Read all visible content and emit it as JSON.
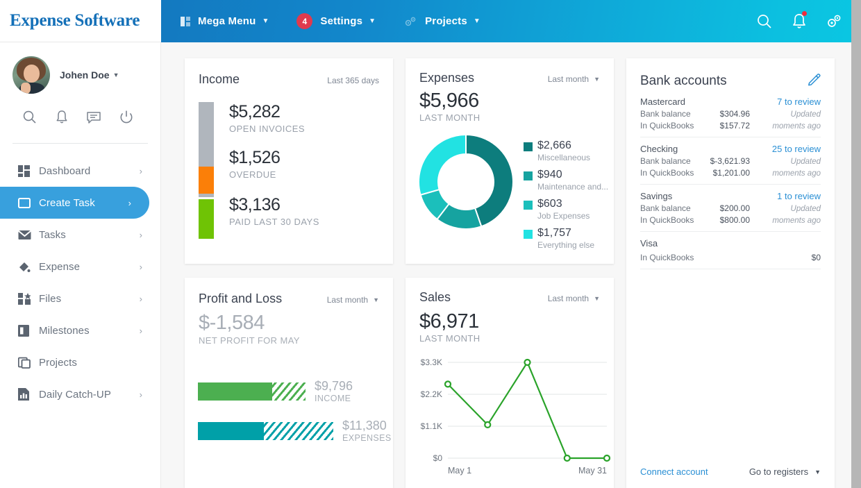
{
  "brand": {
    "title": "Expense Software"
  },
  "navbar": {
    "items": [
      {
        "label": "Mega Menu",
        "icon": "grid-icon",
        "caret": "▼",
        "badge": null
      },
      {
        "label": "Settings",
        "icon": "badge-icon",
        "caret": "▼",
        "badge": "4"
      },
      {
        "label": "Projects",
        "icon": "gears-icon",
        "caret": "▼",
        "badge": null
      }
    ],
    "right_icons": [
      "search-icon",
      "bell-icon",
      "settings-gear-icon"
    ]
  },
  "sidebar": {
    "profile": {
      "name": "Johen Doe",
      "caret": "▼",
      "avatar": "user-avatar"
    },
    "quick_icons": [
      "search-icon",
      "bell-icon",
      "chat-icon",
      "power-icon"
    ],
    "items": [
      {
        "label": "Dashboard",
        "icon": "dashboard-icon",
        "arrow": "›",
        "active": false
      },
      {
        "label": "Create Task",
        "icon": "window-icon",
        "arrow": "›",
        "active": true
      },
      {
        "label": "Tasks",
        "icon": "envelope-icon",
        "arrow": "›",
        "active": false
      },
      {
        "label": "Expense",
        "icon": "paint-icon",
        "arrow": "›",
        "active": false
      },
      {
        "label": "Files",
        "icon": "files-icon",
        "arrow": "›",
        "active": false
      },
      {
        "label": "Milestones",
        "icon": "milestones-icon",
        "arrow": "›",
        "active": false
      },
      {
        "label": "Projects",
        "icon": "projects-icon",
        "arrow": "",
        "active": false
      },
      {
        "label": "Daily Catch-UP",
        "icon": "report-icon",
        "arrow": "›",
        "active": false
      }
    ]
  },
  "income_card": {
    "title": "Income",
    "period": "Last 365 days",
    "rows": [
      {
        "amount": "$5,282",
        "label": "OPEN INVOICES",
        "color": "#b0b6bd"
      },
      {
        "amount": "$1,526",
        "label": "OVERDUE",
        "color": "#fb7f08"
      },
      {
        "amount": "$3,136",
        "label": "PAID LAST 30 DAYS",
        "color": "#6fc305"
      }
    ]
  },
  "expenses_card": {
    "title": "Expenses",
    "period": "Last month",
    "caret": "▼",
    "total": "$5,966",
    "total_label": "LAST MONTH",
    "chart_data": {
      "type": "pie",
      "title": "Expenses",
      "labels": [
        "Miscellaneous",
        "Maintenance and...",
        "Job Expenses",
        "Everything else"
      ],
      "values": [
        2666,
        940,
        603,
        1757
      ],
      "value_labels": [
        "$2,666",
        "$940",
        "$603",
        "$1,757"
      ],
      "colors": [
        "#0d7d7d",
        "#16a3a0",
        "#1bbfbb",
        "#22e2e2"
      ],
      "total": 5966,
      "legend": "right"
    }
  },
  "bank_card": {
    "title": "Bank accounts",
    "edit_icon": "pencil-icon",
    "accounts": [
      {
        "name": "Mastercard",
        "review": "7 to review",
        "lines": [
          {
            "label": "Bank balance",
            "value": "$304.96",
            "note": "Updated"
          },
          {
            "label": "In QuickBooks",
            "value": "$157.72",
            "note": "moments ago"
          }
        ]
      },
      {
        "name": "Checking",
        "review": "25 to review",
        "lines": [
          {
            "label": "Bank balance",
            "value": "$-3,621.93",
            "note": "Updated"
          },
          {
            "label": "In QuickBooks",
            "value": "$1,201.00",
            "note": "moments ago"
          }
        ]
      },
      {
        "name": "Savings",
        "review": "1 to review",
        "lines": [
          {
            "label": "Bank balance",
            "value": "$200.00",
            "note": "Updated"
          },
          {
            "label": "In QuickBooks",
            "value": "$800.00",
            "note": "moments ago"
          }
        ]
      },
      {
        "name": "Visa",
        "review": "",
        "lines": [
          {
            "label": "In QuickBooks",
            "value": "$0",
            "note": ""
          }
        ]
      }
    ],
    "connect_label": "Connect account",
    "registers_label": "Go to registers",
    "registers_caret": "▼"
  },
  "pl_card": {
    "title": "Profit and Loss",
    "period": "Last month",
    "caret": "▼",
    "net": "$-1,584",
    "net_label": "NET PROFIT FOR MAY",
    "chart_data": {
      "type": "bar",
      "title": "Profit and Loss",
      "categories": [
        "INCOME",
        "EXPENSES"
      ],
      "values": [
        9796,
        11380
      ],
      "value_labels": [
        "$9,796",
        "$11,380"
      ],
      "colors": [
        "#4caf50",
        "#00a0a8"
      ],
      "solid_fraction": [
        0.69,
        0.49
      ],
      "orientation": "horizontal"
    }
  },
  "sales_card": {
    "title": "Sales",
    "period": "Last month",
    "caret": "▼",
    "total": "$6,971",
    "total_label": "LAST MONTH",
    "chart_data": {
      "type": "line",
      "title": "Sales",
      "x": [
        "May 1",
        "",
        "",
        "",
        "May 31"
      ],
      "x_tick_labels": [
        "May 1",
        "May 31"
      ],
      "values": [
        2550,
        1150,
        3300,
        0,
        0
      ],
      "y_tick_labels": [
        "$3.3K",
        "$2.2K",
        "$1.1K",
        "$0"
      ],
      "y_ticks": [
        3300,
        2200,
        1100,
        0
      ],
      "ylim": [
        0,
        3300
      ],
      "color": "#2aa32a",
      "grid": true,
      "legend": "none"
    }
  }
}
